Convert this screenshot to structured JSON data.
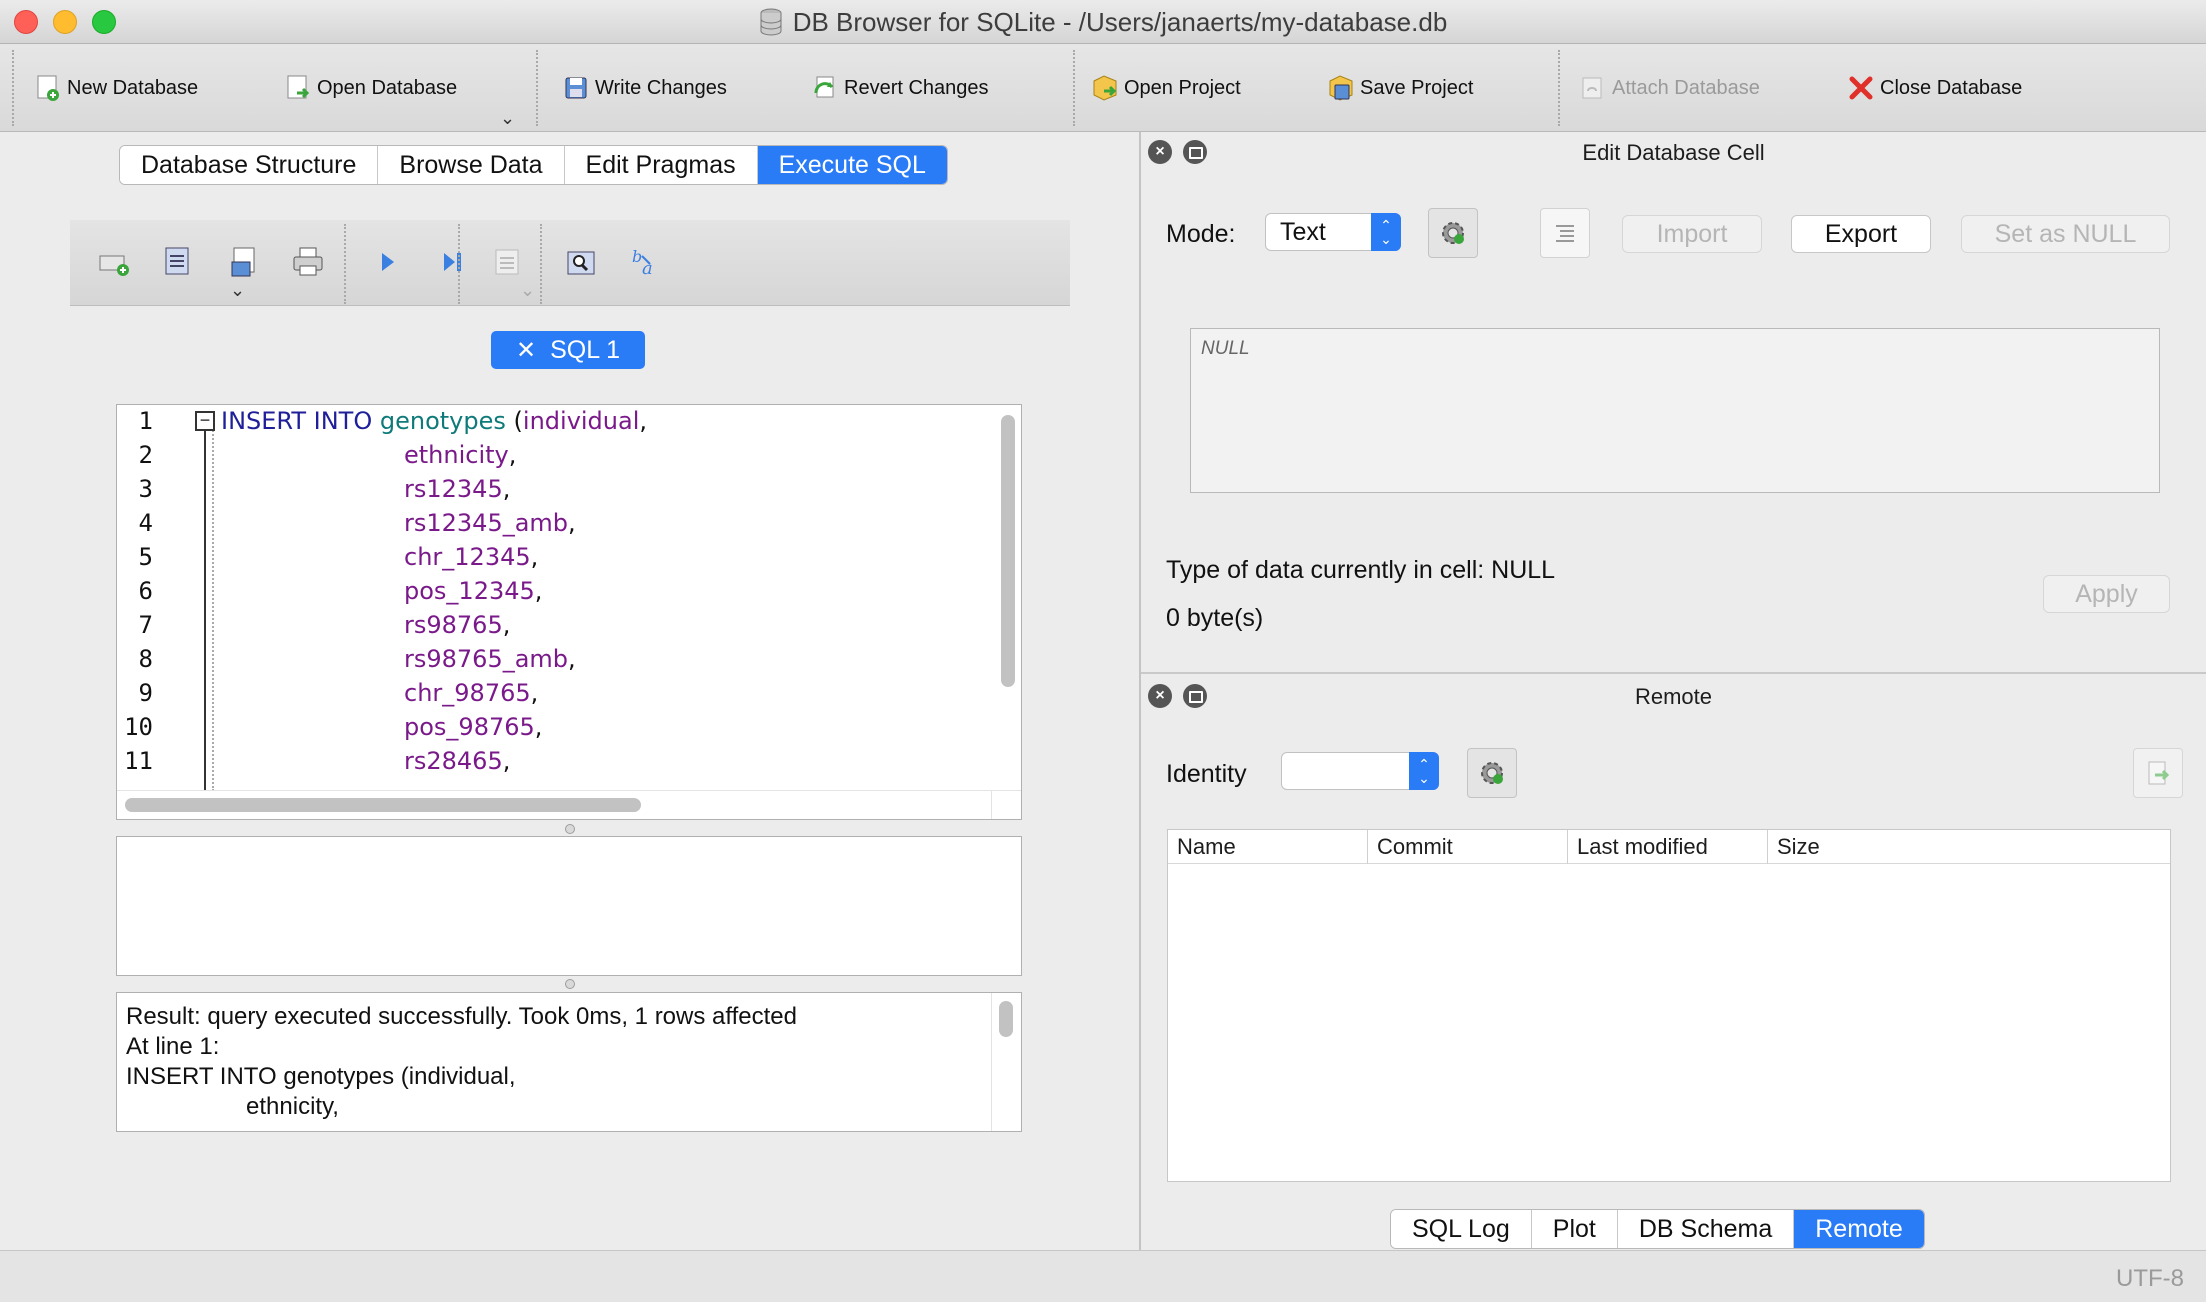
{
  "window": {
    "title": "DB Browser for SQLite - /Users/janaerts/my-database.db"
  },
  "toolbar": {
    "new_database": "New Database",
    "open_database": "Open Database",
    "write_changes": "Write Changes",
    "revert_changes": "Revert Changes",
    "open_project": "Open Project",
    "save_project": "Save Project",
    "attach_database": "Attach Database",
    "close_database": "Close Database"
  },
  "main_tabs": [
    {
      "label": "Database Structure"
    },
    {
      "label": "Browse Data"
    },
    {
      "label": "Edit Pragmas"
    },
    {
      "label": "Execute SQL"
    }
  ],
  "active_main_tab": "Execute SQL",
  "sql_tab": {
    "close_glyph": "✕",
    "label": "SQL 1"
  },
  "editor": {
    "line_numbers": [
      "1",
      "2",
      "3",
      "4",
      "5",
      "6",
      "7",
      "8",
      "9",
      "10",
      "11"
    ],
    "line1": {
      "kw": "INSERT INTO",
      "table": "genotypes",
      "open": "(",
      "col": "individual",
      "comma": ","
    },
    "columns": [
      "ethnicity",
      "rs12345",
      "rs12345_amb",
      "chr_12345",
      "pos_12345",
      "rs98765",
      "rs98765_amb",
      "chr_98765",
      "pos_98765",
      "rs28465"
    ],
    "trailing": ","
  },
  "message": {
    "lines": [
      "Result: query executed successfully. Took 0ms, 1 rows affected",
      "At line 1:",
      "INSERT INTO genotypes (individual,",
      "                  ethnicity,"
    ]
  },
  "edit_cell": {
    "title": "Edit Database Cell",
    "mode_label": "Mode:",
    "mode_value": "Text",
    "import": "Import",
    "export": "Export",
    "set_null": "Set as NULL",
    "cell_value": "NULL",
    "type_info": "Type of data currently in cell: NULL",
    "size_info": "0 byte(s)",
    "apply": "Apply"
  },
  "remote": {
    "title": "Remote",
    "identity_label": "Identity",
    "identity_value": "",
    "columns": [
      "Name",
      "Commit",
      "Last modified",
      "Size"
    ]
  },
  "bottom_tabs": [
    {
      "label": "SQL Log"
    },
    {
      "label": "Plot"
    },
    {
      "label": "DB Schema"
    },
    {
      "label": "Remote"
    }
  ],
  "active_bottom_tab": "Remote",
  "status": {
    "encoding": "UTF-8"
  },
  "colors": {
    "accent": "#2a7cf6",
    "keyword": "#1f1f9a",
    "table_name": "#0f7a7a",
    "column_name": "#7a1a8a"
  }
}
